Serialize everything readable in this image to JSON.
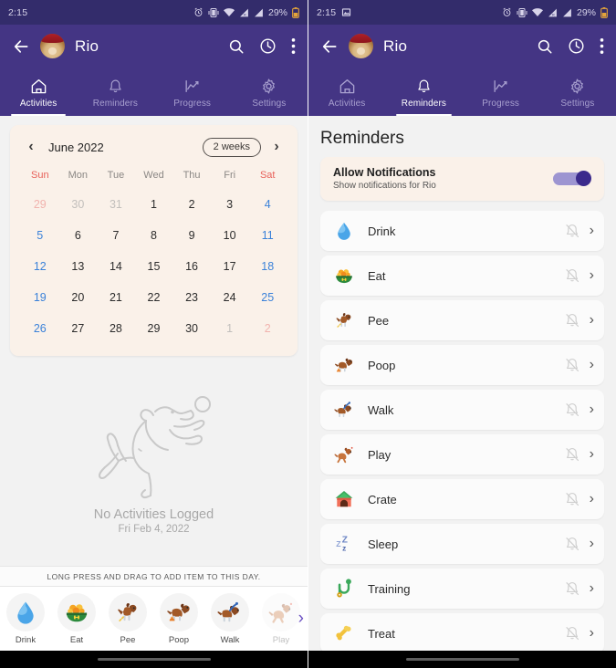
{
  "status_bar": {
    "time": "2:15",
    "battery": "29%",
    "icons": [
      "image-icon",
      "alarm-icon",
      "vibrate-icon",
      "wifi-icon",
      "signal-r-icon",
      "signal-icon",
      "battery-icon"
    ]
  },
  "app_bar": {
    "back_icon": "back-arrow-icon",
    "avatar_name": "dog-avatar",
    "title": "Rio",
    "actions": [
      "search-icon",
      "clock-icon",
      "overflow-menu-icon"
    ]
  },
  "tabs": [
    {
      "label": "Activities",
      "icon": "home-icon"
    },
    {
      "label": "Reminders",
      "icon": "bell-icon"
    },
    {
      "label": "Progress",
      "icon": "chart-line-icon"
    },
    {
      "label": "Settings",
      "icon": "gear-icon"
    }
  ],
  "left_screen": {
    "active_tab": "Activities",
    "calendar": {
      "prev_icon": "chevron-left-icon",
      "next_icon": "chevron-right-icon",
      "month_label": "June 2022",
      "range_pill": "2 weeks",
      "day_headers": [
        "Sun",
        "Mon",
        "Tue",
        "Wed",
        "Thu",
        "Fri",
        "Sat"
      ],
      "weeks": [
        [
          {
            "d": "29",
            "out": true,
            "kind": "sun"
          },
          {
            "d": "30",
            "out": true,
            "kind": ""
          },
          {
            "d": "31",
            "out": true,
            "kind": ""
          },
          {
            "d": "1",
            "out": false,
            "kind": ""
          },
          {
            "d": "2",
            "out": false,
            "kind": ""
          },
          {
            "d": "3",
            "out": false,
            "kind": ""
          },
          {
            "d": "4",
            "out": false,
            "kind": "sat"
          }
        ],
        [
          {
            "d": "5",
            "out": false,
            "kind": "sun"
          },
          {
            "d": "6",
            "out": false,
            "kind": ""
          },
          {
            "d": "7",
            "out": false,
            "kind": ""
          },
          {
            "d": "8",
            "out": false,
            "kind": ""
          },
          {
            "d": "9",
            "out": false,
            "kind": ""
          },
          {
            "d": "10",
            "out": false,
            "kind": ""
          },
          {
            "d": "11",
            "out": false,
            "kind": "sat"
          }
        ],
        [
          {
            "d": "12",
            "out": false,
            "kind": "sun"
          },
          {
            "d": "13",
            "out": false,
            "kind": ""
          },
          {
            "d": "14",
            "out": false,
            "kind": ""
          },
          {
            "d": "15",
            "out": false,
            "kind": ""
          },
          {
            "d": "16",
            "out": false,
            "kind": ""
          },
          {
            "d": "17",
            "out": false,
            "kind": ""
          },
          {
            "d": "18",
            "out": false,
            "kind": "sat"
          }
        ],
        [
          {
            "d": "19",
            "out": false,
            "kind": "sun"
          },
          {
            "d": "20",
            "out": false,
            "kind": ""
          },
          {
            "d": "21",
            "out": false,
            "kind": ""
          },
          {
            "d": "22",
            "out": false,
            "kind": ""
          },
          {
            "d": "23",
            "out": false,
            "kind": ""
          },
          {
            "d": "24",
            "out": false,
            "kind": ""
          },
          {
            "d": "25",
            "out": false,
            "kind": "sat"
          }
        ],
        [
          {
            "d": "26",
            "out": false,
            "kind": "sun"
          },
          {
            "d": "27",
            "out": false,
            "kind": ""
          },
          {
            "d": "28",
            "out": false,
            "kind": ""
          },
          {
            "d": "29",
            "out": false,
            "kind": ""
          },
          {
            "d": "30",
            "out": false,
            "kind": ""
          },
          {
            "d": "1",
            "out": true,
            "kind": ""
          },
          {
            "d": "2",
            "out": true,
            "kind": "sat"
          }
        ]
      ]
    },
    "empty_state": {
      "illustration": "jumping-dog-with-ball-outline",
      "title": "No Activities Logged",
      "date": "Fri Feb 4, 2022"
    },
    "hint": "LONG PRESS AND DRAG TO ADD ITEM TO THIS DAY.",
    "quick_items": [
      {
        "label": "Drink",
        "icon": "water-drop-icon",
        "faded": false
      },
      {
        "label": "Eat",
        "icon": "food-bowl-icon",
        "faded": false
      },
      {
        "label": "Pee",
        "icon": "dog-pee-icon",
        "faded": false
      },
      {
        "label": "Poop",
        "icon": "dog-poop-icon",
        "faded": false
      },
      {
        "label": "Walk",
        "icon": "dog-walk-icon",
        "faded": false
      },
      {
        "label": "Play",
        "icon": "dog-play-icon",
        "faded": true
      }
    ],
    "quick_next_icon": "chevron-right-icon"
  },
  "right_screen": {
    "active_tab": "Reminders",
    "page_title": "Reminders",
    "allow_notifications": {
      "title": "Allow Notifications",
      "subtitle": "Show notifications for Rio",
      "enabled": true
    },
    "reminders": [
      {
        "label": "Drink",
        "icon": "water-drop-icon",
        "notify_icon": "bell-off-icon",
        "chevron": "chevron-right-icon"
      },
      {
        "label": "Eat",
        "icon": "food-bowl-icon",
        "notify_icon": "bell-off-icon",
        "chevron": "chevron-right-icon"
      },
      {
        "label": "Pee",
        "icon": "dog-pee-icon",
        "notify_icon": "bell-off-icon",
        "chevron": "chevron-right-icon"
      },
      {
        "label": "Poop",
        "icon": "dog-poop-icon",
        "notify_icon": "bell-off-icon",
        "chevron": "chevron-right-icon"
      },
      {
        "label": "Walk",
        "icon": "dog-walk-icon",
        "notify_icon": "bell-off-icon",
        "chevron": "chevron-right-icon"
      },
      {
        "label": "Play",
        "icon": "dog-play-icon",
        "notify_icon": "bell-off-icon",
        "chevron": "chevron-right-icon"
      },
      {
        "label": "Crate",
        "icon": "dog-house-icon",
        "notify_icon": "bell-off-icon",
        "chevron": "chevron-right-icon"
      },
      {
        "label": "Sleep",
        "icon": "zzz-icon",
        "notify_icon": "bell-off-icon",
        "chevron": "chevron-right-icon"
      },
      {
        "label": "Training",
        "icon": "leash-icon",
        "notify_icon": "bell-off-icon",
        "chevron": "chevron-right-icon"
      },
      {
        "label": "Treat",
        "icon": "bone-icon",
        "notify_icon": "bell-off-icon",
        "chevron": "chevron-right-icon"
      }
    ]
  },
  "colors": {
    "app_bar": "#443584",
    "status_bar": "#332c6b",
    "card_cream": "#faf1e9",
    "page_bg": "#f2f2f2",
    "accent_blue": "#3b82d9",
    "accent_red": "#e8615a",
    "toggle_thumb": "#3b2a8c",
    "toggle_track": "#9d95d1"
  }
}
